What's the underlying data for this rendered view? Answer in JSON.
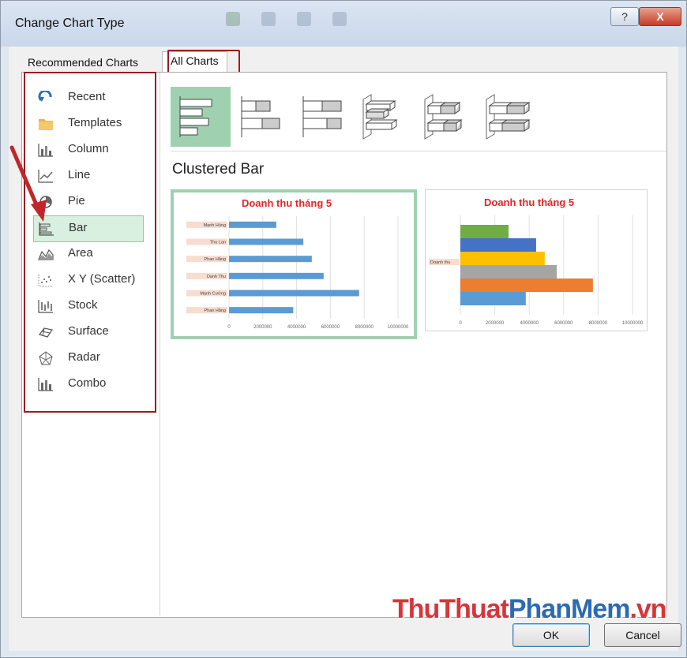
{
  "window": {
    "title": "Change Chart Type"
  },
  "controls": {
    "help": "?",
    "close": "X"
  },
  "tabs": [
    {
      "label": "Recommended Charts",
      "active": false
    },
    {
      "label": "All Charts",
      "active": true
    }
  ],
  "sidebar": {
    "items": [
      {
        "label": "Recent",
        "icon": "recent-icon",
        "selected": false
      },
      {
        "label": "Templates",
        "icon": "folder-icon",
        "selected": false
      },
      {
        "label": "Column",
        "icon": "column-chart-icon",
        "selected": false
      },
      {
        "label": "Line",
        "icon": "line-chart-icon",
        "selected": false
      },
      {
        "label": "Pie",
        "icon": "pie-chart-icon",
        "selected": false
      },
      {
        "label": "Bar",
        "icon": "bar-chart-icon",
        "selected": true
      },
      {
        "label": "Area",
        "icon": "area-chart-icon",
        "selected": false
      },
      {
        "label": "X Y (Scatter)",
        "icon": "scatter-chart-icon",
        "selected": false
      },
      {
        "label": "Stock",
        "icon": "stock-chart-icon",
        "selected": false
      },
      {
        "label": "Surface",
        "icon": "surface-chart-icon",
        "selected": false
      },
      {
        "label": "Radar",
        "icon": "radar-chart-icon",
        "selected": false
      },
      {
        "label": "Combo",
        "icon": "combo-chart-icon",
        "selected": false
      }
    ]
  },
  "subtypes": [
    {
      "icon": "clustered-bar-icon",
      "selected": true
    },
    {
      "icon": "stacked-bar-icon",
      "selected": false
    },
    {
      "icon": "100-stacked-bar-icon",
      "selected": false
    },
    {
      "icon": "3d-clustered-bar-icon",
      "selected": false
    },
    {
      "icon": "3d-stacked-bar-icon",
      "selected": false
    },
    {
      "icon": "3d-100-stacked-bar-icon",
      "selected": false
    }
  ],
  "selected_subtype_label": "Clustered Bar",
  "colors": {
    "accent_green": "#9fd1b1",
    "highlight_red": "#9b1c22",
    "bar_blue": "#5b9bd5",
    "title_red": "#e3262a"
  },
  "chart_data": [
    {
      "type": "bar",
      "title": "Doanh thu tháng 5",
      "categories": [
        "Mạnh Hùng",
        "Thu Lan",
        "Phan Hằng",
        "Danh Thu",
        "Mạnh Cường",
        "Phan Hằng"
      ],
      "values": [
        2800000,
        4400000,
        4900000,
        5600000,
        7700000,
        3800000
      ],
      "xlim": [
        0,
        10000000
      ],
      "xticks": [
        "0",
        "2000000",
        "4000000",
        "6000000",
        "8000000",
        "10000000"
      ],
      "series_color": "#5b9bd5",
      "grid": true
    },
    {
      "type": "bar",
      "title": "Doanh thu tháng 5",
      "categories": [
        "Doanh thu"
      ],
      "series": [
        {
          "values": [
            2800000
          ],
          "color": "#70ad47"
        },
        {
          "values": [
            4400000
          ],
          "color": "#4472c4"
        },
        {
          "values": [
            4900000
          ],
          "color": "#ffc000"
        },
        {
          "values": [
            5600000
          ],
          "color": "#a5a5a5"
        },
        {
          "values": [
            7700000
          ],
          "color": "#ed7d31"
        },
        {
          "values": [
            3800000
          ],
          "color": "#5b9bd5"
        }
      ],
      "xlim": [
        0,
        10000000
      ],
      "xticks": [
        "0",
        "2000000",
        "4000000",
        "6000000",
        "8000000",
        "10000000"
      ],
      "grid": true
    }
  ],
  "watermark": {
    "part1": "ThuThuat",
    "part2": "PhanMem",
    "part3": ".vn"
  },
  "buttons": {
    "ok": "OK",
    "cancel": "Cancel"
  }
}
